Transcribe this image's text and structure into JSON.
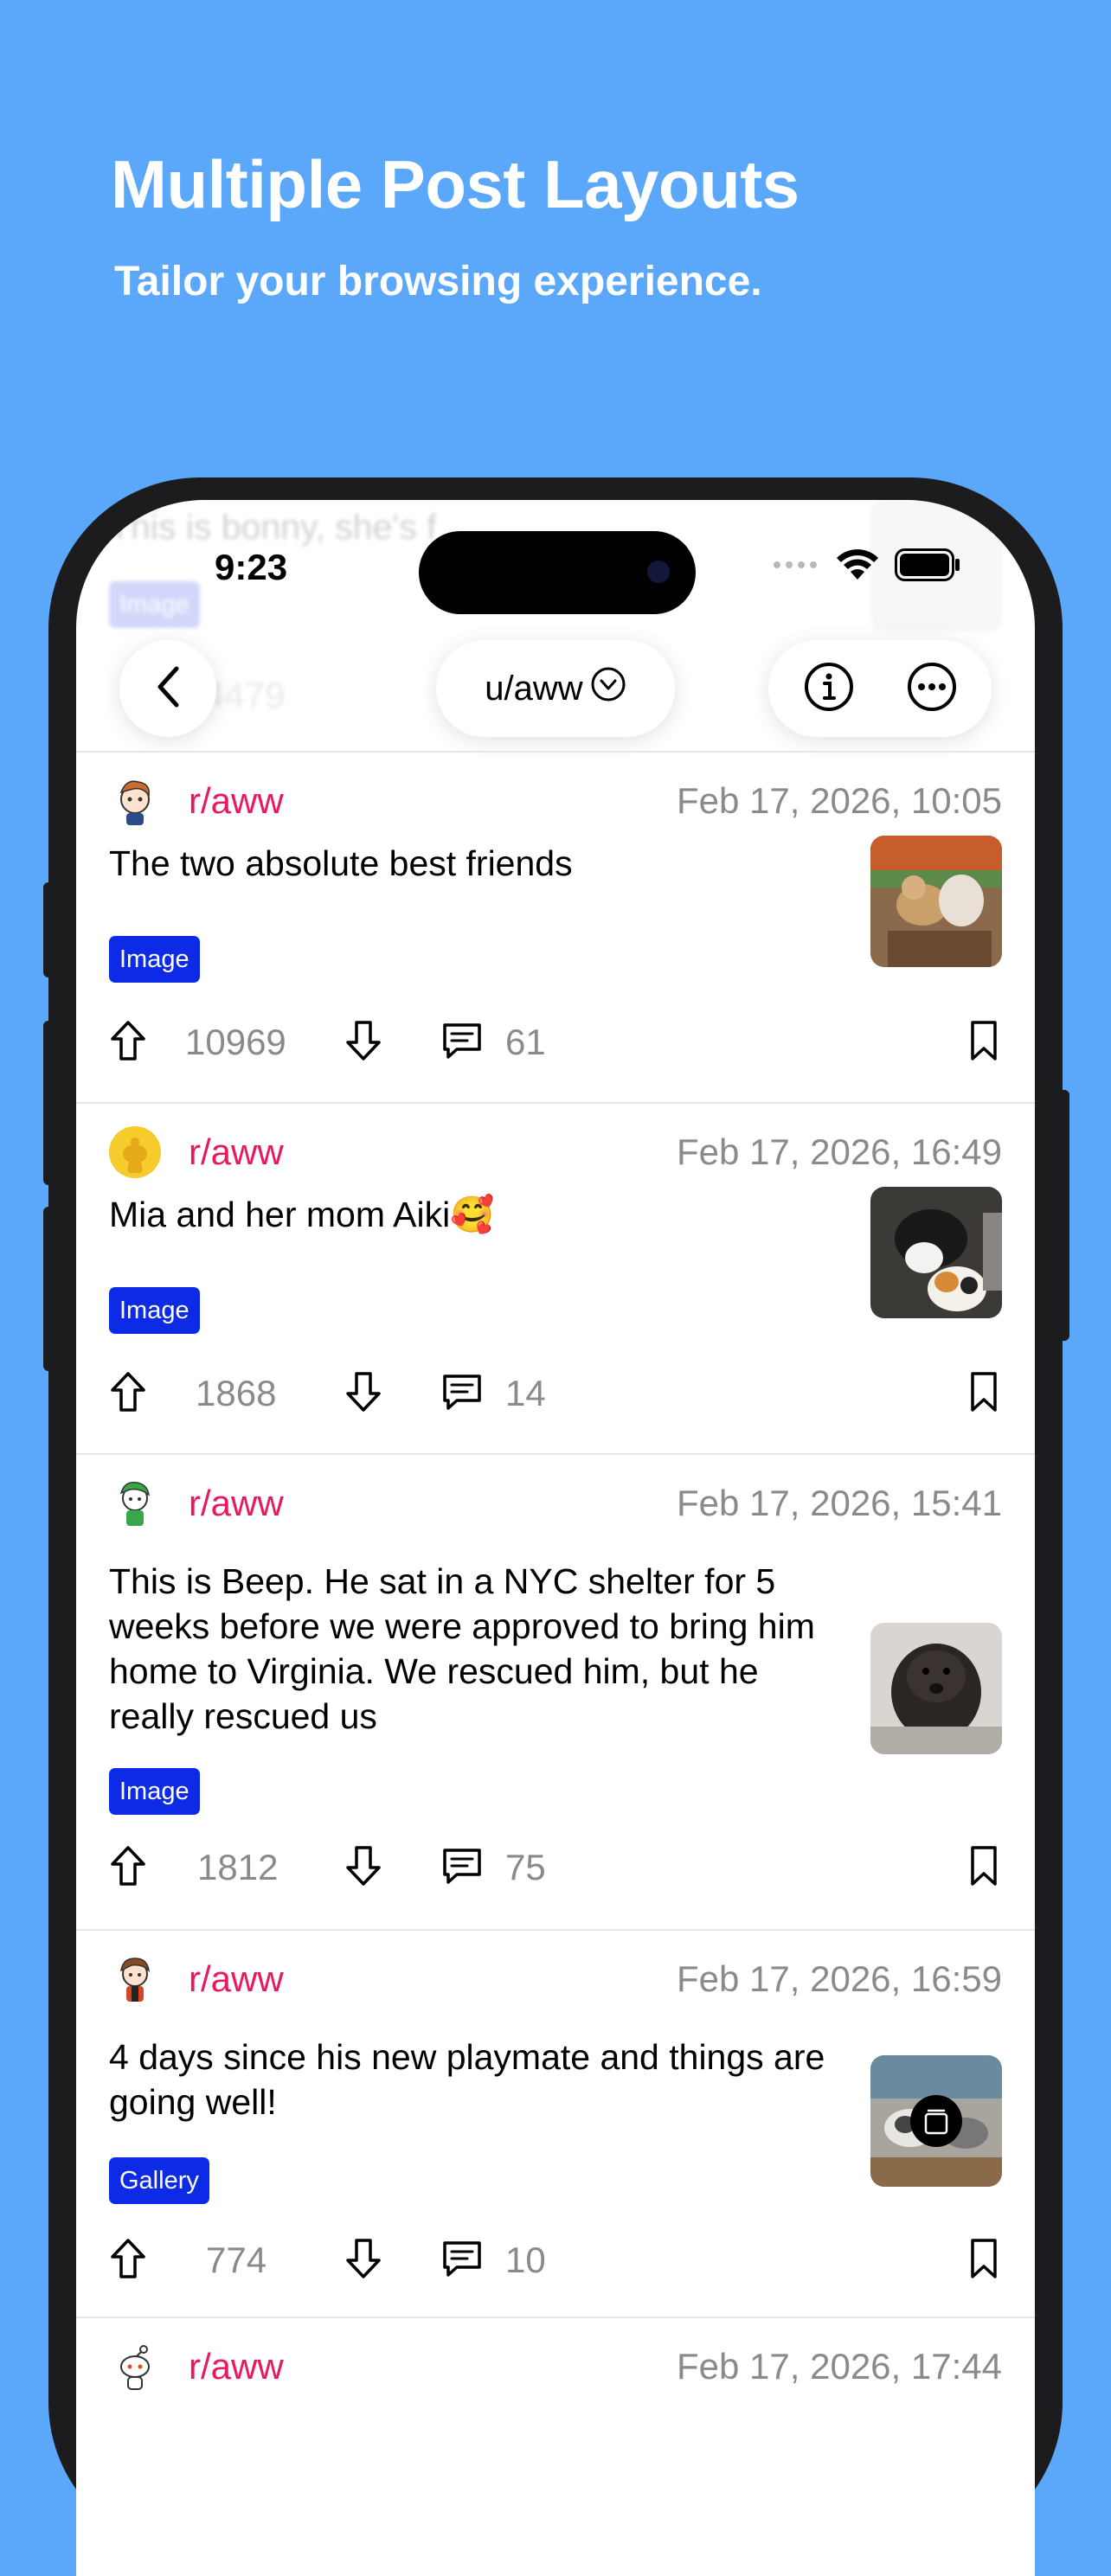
{
  "promo": {
    "title": "Multiple Post Layouts",
    "subtitle": "Tailor your browsing experience."
  },
  "status_bar": {
    "time": "9:23"
  },
  "nav": {
    "title": "u/aww"
  },
  "ghost": {
    "text": "This is bonny, she's f",
    "badge": "Image",
    "count": "4479"
  },
  "posts": [
    {
      "subreddit": "r/aww",
      "date": "Feb 17, 2026, 10:05",
      "title": "The two absolute best friends",
      "badge": "Image",
      "upvotes": "10969",
      "comments": "61"
    },
    {
      "subreddit": "r/aww",
      "date": "Feb 17, 2026, 16:49",
      "title": "Mia and her mom Aiki🥰",
      "badge": "Image",
      "upvotes": "1868",
      "comments": "14"
    },
    {
      "subreddit": "r/aww",
      "date": "Feb 17, 2026, 15:41",
      "title": "This is Beep. He sat in a NYC shelter for 5 weeks before we were approved to bring him home to Virginia. We rescued him, but he really rescued us",
      "badge": "Image",
      "upvotes": "1812",
      "comments": "75"
    },
    {
      "subreddit": "r/aww",
      "date": "Feb 17, 2026, 16:59",
      "title": "4 days since his new playmate and things are going well!",
      "badge": "Gallery",
      "upvotes": "774",
      "comments": "10"
    },
    {
      "subreddit": "r/aww",
      "date": "Feb 17, 2026, 17:44"
    }
  ],
  "colors": {
    "background": "#5ba8fb",
    "subreddit": "#e8195f",
    "badge": "#0d2be6",
    "meta": "#8a8a8e"
  },
  "icons": [
    "chevron-left-icon",
    "chevron-down-circle-icon",
    "info-icon",
    "more-icon",
    "upvote-icon",
    "downvote-icon",
    "comment-icon",
    "bookmark-icon",
    "share-icon",
    "gallery-stack-icon",
    "wifi-icon",
    "battery-icon"
  ]
}
